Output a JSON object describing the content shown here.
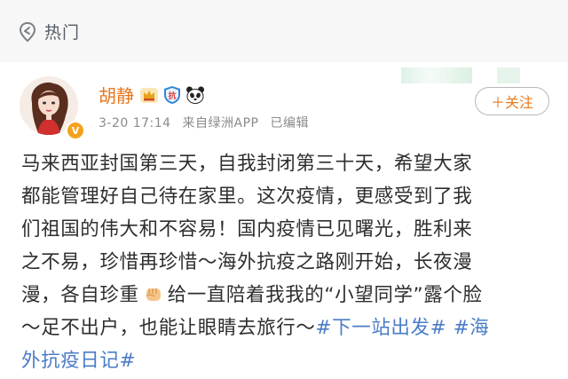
{
  "hot": {
    "label": "热门"
  },
  "post": {
    "username": "胡静",
    "verified_badge": "V",
    "timestamp": "3-20 17:14",
    "source": "来自绿洲APP",
    "edited": "已编辑",
    "follow_label": "＋关注",
    "badges": [
      "crown-icon",
      "anti-epidemic-badge-icon",
      "panda-icon"
    ],
    "lines": [
      {
        "a": "马来西亚封国第三天，自我封闭第三十天，希望大家"
      },
      {
        "a": "都能管理好自己待在家里。这次疫情，更感受到了我"
      },
      {
        "a": "们祖国的伟大和不容易！国内疫情已见曙光，胜利来"
      },
      {
        "a": "之不易，珍惜再珍惜～海外抗疫之路刚开始，长夜漫"
      },
      {
        "a": "漫，各自珍重",
        "b": "给一直陪着我我的“小望同学”露个脸"
      },
      {
        "a": "～足不出户，也能让眼睛去旅行～",
        "tag1": "#下一站出发#",
        "tag2": "#海"
      },
      {
        "tag2b": "外抗疫日记#"
      }
    ]
  },
  "colors": {
    "username": "#e8761c",
    "hashtag": "#4a7cc7",
    "follow": "#ea7a1e"
  }
}
